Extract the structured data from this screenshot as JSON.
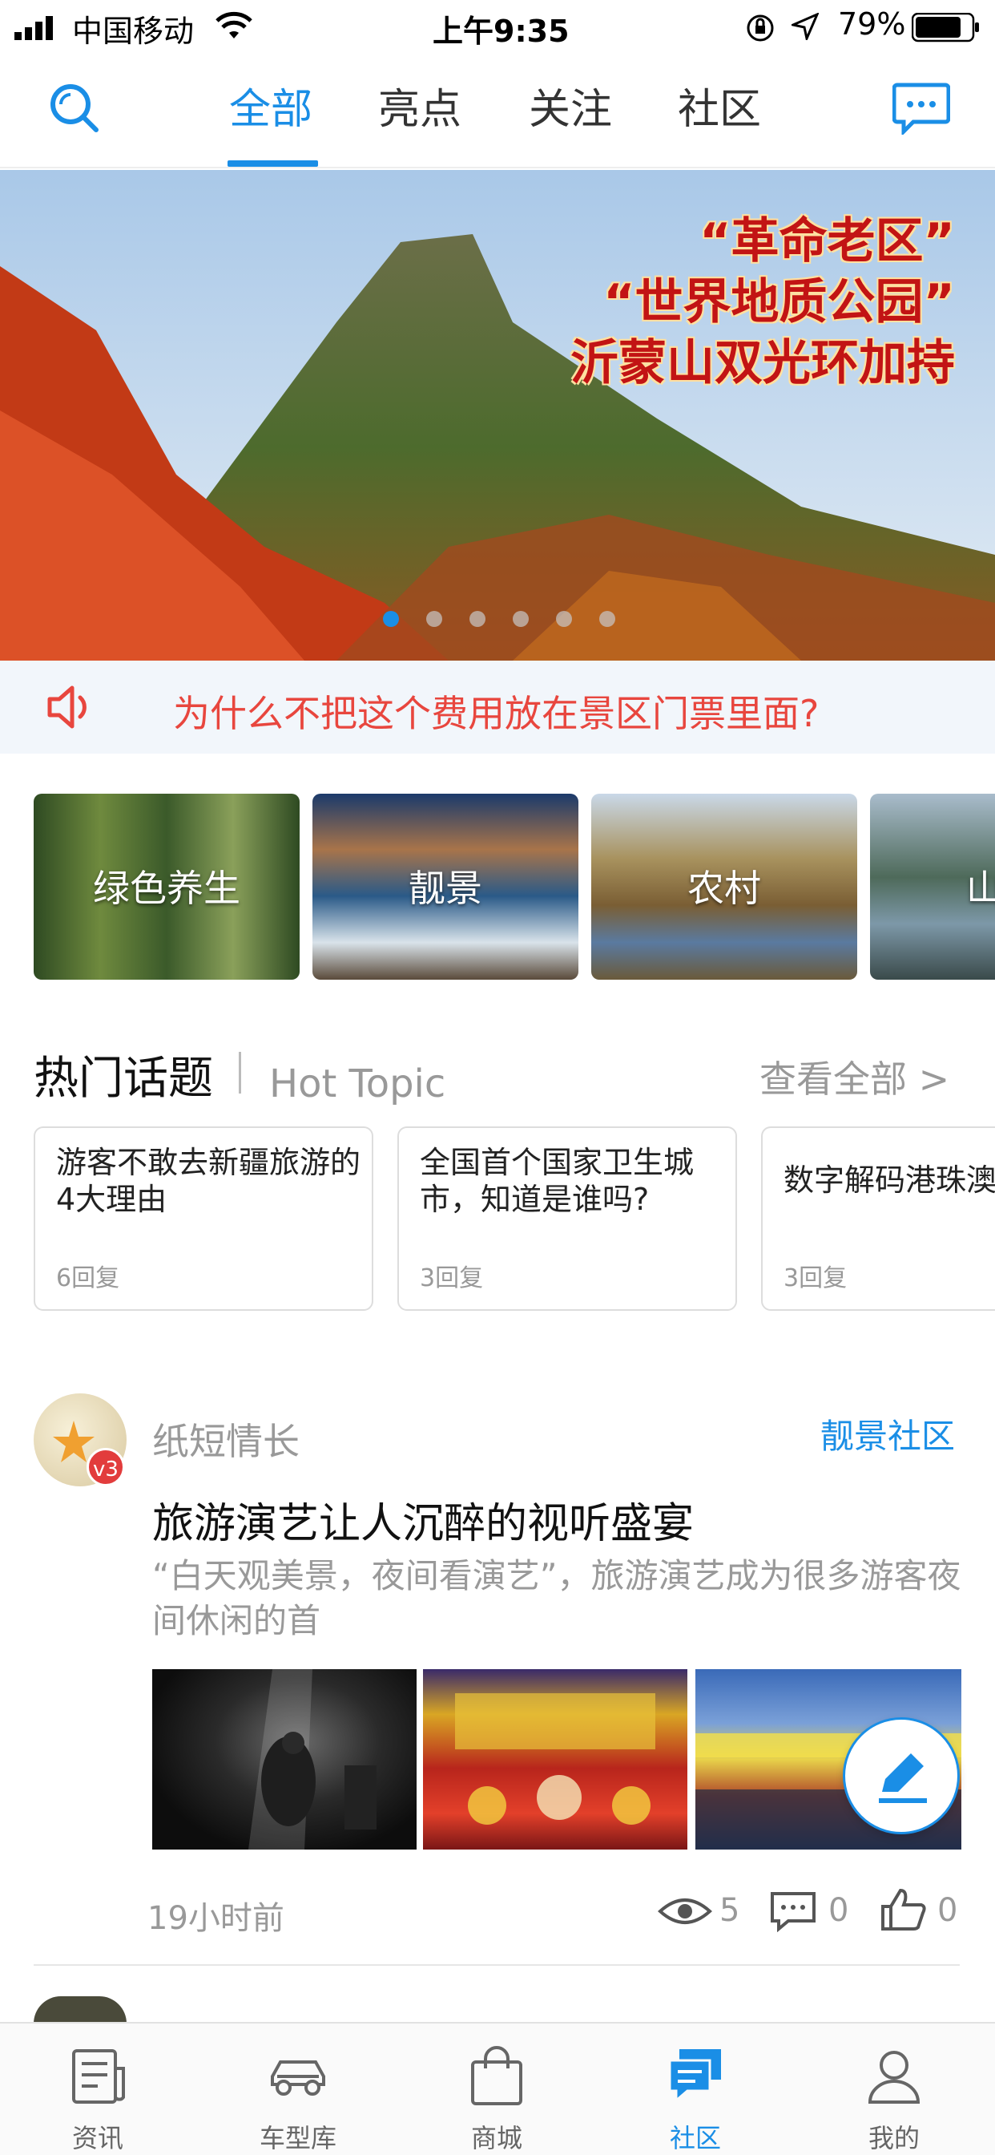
{
  "status_bar": {
    "carrier": "中国移动",
    "time": "上午9:35",
    "battery": "79%"
  },
  "top_nav": {
    "tabs": [
      "全部",
      "亮点",
      "关注",
      "社区"
    ],
    "active_tab": "全部"
  },
  "banner": {
    "lines": [
      "“革命老区”",
      "“世界地质公园”",
      "沂蒙山双光环加持"
    ],
    "page_count": 6,
    "active_page": 1
  },
  "notice": {
    "text": "为什么不把这个费用放在景区门票里面?"
  },
  "categories": [
    "绿色养生",
    "靓景",
    "农村",
    "山"
  ],
  "hot_topics": {
    "title": "热门话题",
    "subtitle": "Hot Topic",
    "view_all": "查看全部 >",
    "items": [
      {
        "title": "游客不敢去新疆旅游的4大理由",
        "replies": "6回复"
      },
      {
        "title": "全国首个国家卫生城市，知道是谁吗?",
        "replies": "3回复"
      },
      {
        "title": "数字解码港珠澳",
        "replies": "3回复"
      }
    ]
  },
  "post": {
    "author": "纸短情长",
    "badge": "v3",
    "community": "靓景社区",
    "title": "旅游演艺让人沉醉的视听盛宴",
    "excerpt": "“白天观美景，夜间看演艺”，旅游演艺成为很多游客夜间休闲的首",
    "time": "19小时前",
    "views": "5",
    "comments": "0",
    "likes": "0"
  },
  "bottom_tabs": {
    "items": [
      "资讯",
      "车型库",
      "商城",
      "社区",
      "我的"
    ],
    "active": "社区"
  },
  "colors": {
    "accent": "#1a8ee6",
    "notice_text": "#e8463e",
    "badge": "#e23c3c"
  }
}
